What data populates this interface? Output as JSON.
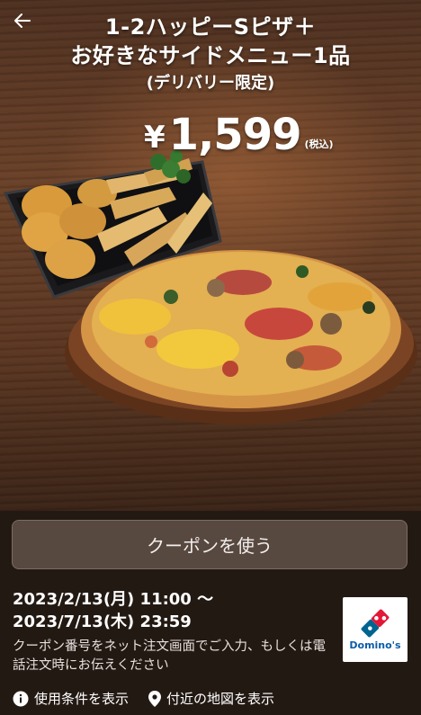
{
  "header": {
    "back_icon": "arrow-left-icon",
    "title_line1": "1-2ハッピーSピザ＋",
    "title_line2": "お好きなサイドメニュー1品",
    "subtitle": "(デリバリー限定)",
    "price_symbol": "¥",
    "price": "1,599",
    "tax_note": "(税込)"
  },
  "coupon": {
    "use_button_label": "クーポンを使う",
    "valid_from": "2023/2/13(月) 11:00 〜",
    "valid_to": "2023/7/13(木) 23:59",
    "note": "クーポン番号をネット注文画面でご入力、もしくは電話注文時にお伝えください"
  },
  "logo": {
    "text": "Domino's",
    "colors": {
      "red": "#e31837",
      "blue": "#006491"
    }
  },
  "links": {
    "terms_label": "使用条件を表示",
    "terms_icon": "info-icon",
    "map_label": "付近の地図を表示",
    "map_icon": "location-pin-icon"
  },
  "colors": {
    "background": "#241a14",
    "button_bg": "#574840",
    "button_border": "#7b6d64"
  }
}
